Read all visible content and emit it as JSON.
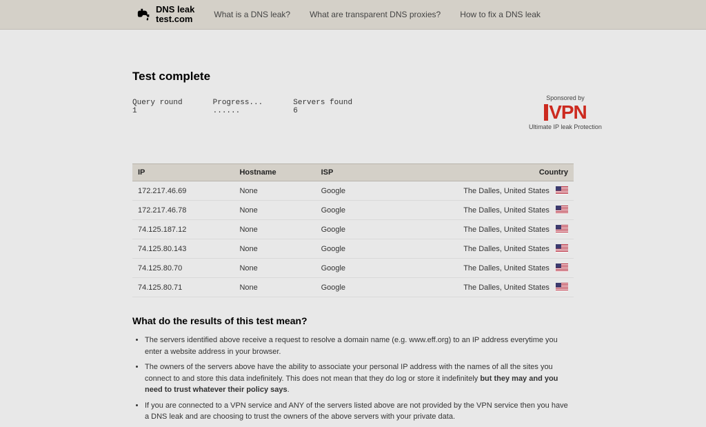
{
  "brand": {
    "line1": "DNS leak",
    "line2": "test.com"
  },
  "nav": {
    "link1": "What is a DNS leak?",
    "link2": "What are transparent DNS proxies?",
    "link3": "How to fix a DNS leak"
  },
  "title": "Test complete",
  "meta": {
    "round_label": "Query round",
    "round_value": "1",
    "progress_label": "Progress...",
    "progress_value": "......",
    "servers_label": "Servers found",
    "servers_value": "6"
  },
  "sponsor": {
    "pre": "Sponsored by",
    "name": "IVPN",
    "tag": "Ultimate IP leak Protection"
  },
  "table": {
    "headers": {
      "ip": "IP",
      "host": "Hostname",
      "isp": "ISP",
      "country": "Country"
    },
    "rows": [
      {
        "ip": "172.217.46.69",
        "host": "None",
        "isp": "Google",
        "loc": "The Dalles, United States"
      },
      {
        "ip": "172.217.46.78",
        "host": "None",
        "isp": "Google",
        "loc": "The Dalles, United States"
      },
      {
        "ip": "74.125.187.12",
        "host": "None",
        "isp": "Google",
        "loc": "The Dalles, United States"
      },
      {
        "ip": "74.125.80.143",
        "host": "None",
        "isp": "Google",
        "loc": "The Dalles, United States"
      },
      {
        "ip": "74.125.80.70",
        "host": "None",
        "isp": "Google",
        "loc": "The Dalles, United States"
      },
      {
        "ip": "74.125.80.71",
        "host": "None",
        "isp": "Google",
        "loc": "The Dalles, United States"
      }
    ]
  },
  "explain": {
    "heading": "What do the results of this test mean?",
    "p1": "The servers identified above receive a request to resolve a domain name (e.g. www.eff.org) to an IP address everytime you enter a website address in your browser.",
    "p2a": "The owners of the servers above have the ability to associate your personal IP address with the names of all the sites you connect to and store this data indefinitely. This does not mean that they do log or store it indefinitely ",
    "p2b": "but they may and you need to trust whatever their policy says",
    "p2c": ".",
    "p3": "If you are connected to a VPN service and ANY of the servers listed above are not provided by the VPN service then you have a DNS leak and are choosing to trust the owners of the above servers with your private data."
  }
}
